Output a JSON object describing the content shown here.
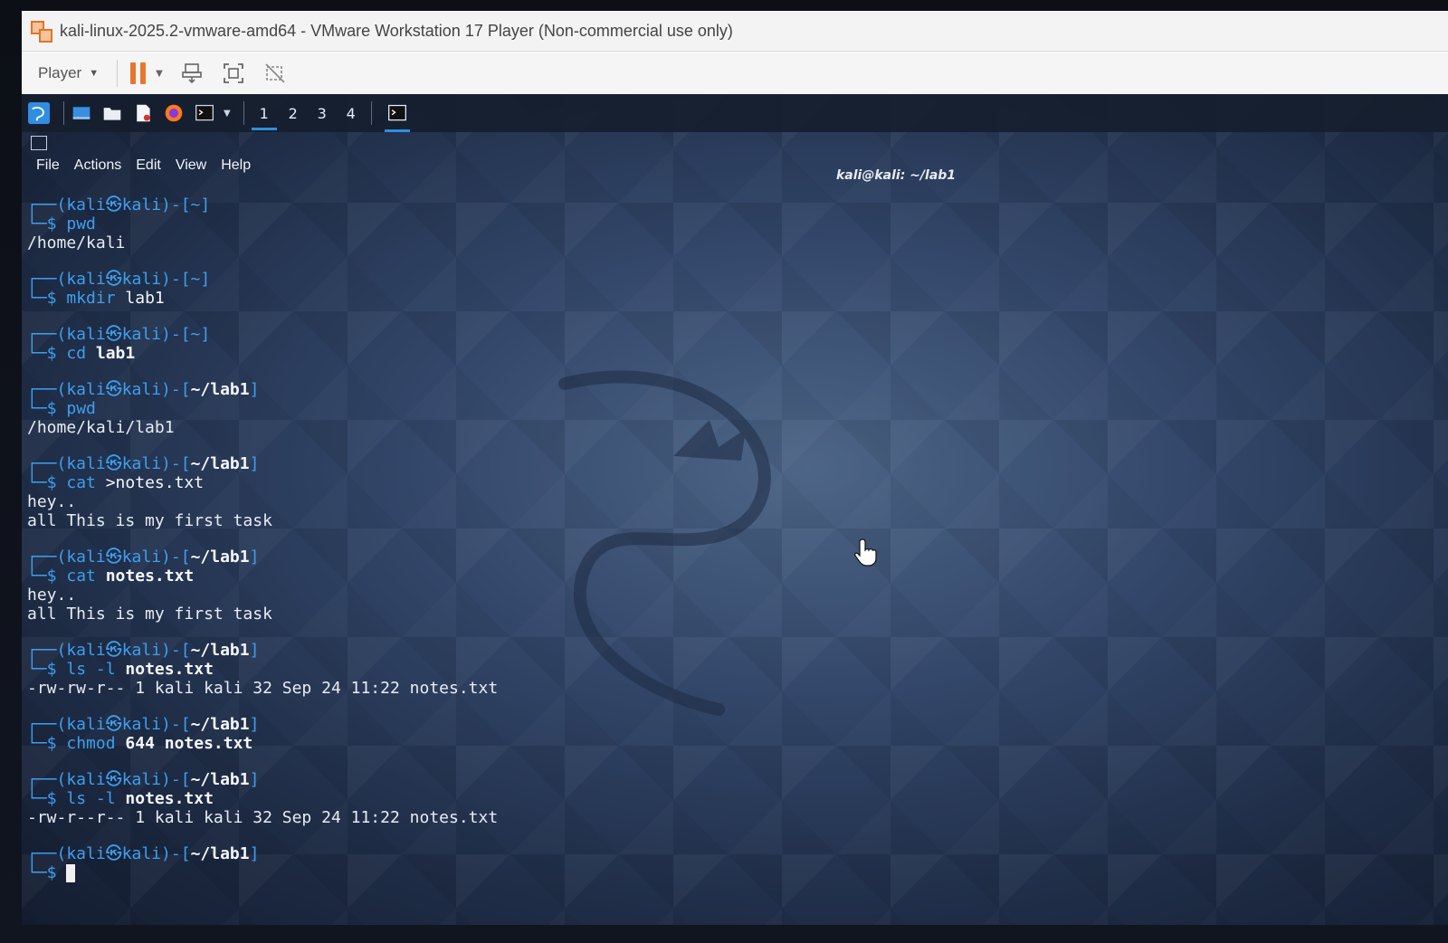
{
  "window": {
    "title": "kali-linux-2025.2-vmware-amd64 - VMware Workstation 17 Player (Non-commercial use only)"
  },
  "toolbar": {
    "player_label": "Player",
    "icons": [
      "pause-icon",
      "send-ctrl-alt-del-icon",
      "fullscreen-icon",
      "unity-icon"
    ]
  },
  "taskbar": {
    "workspaces": [
      "1",
      "2",
      "3",
      "4"
    ],
    "active_workspace": "1"
  },
  "terminal": {
    "title": "kali@kali: ~/lab1",
    "menu": [
      "File",
      "Actions",
      "Edit",
      "View",
      "Help"
    ],
    "lines": {
      "b1_prompt": "┌──(kali㉿kali)-[~]",
      "b1_cmd_a": "└─$ ",
      "b1_cmd_b": "pwd",
      "b1_out1": "/home/kali",
      "b2_prompt": "┌──(kali㉿kali)-[~]",
      "b2_cmd_a": "└─$ ",
      "b2_cmd_b": "mkdir ",
      "b2_cmd_c": "lab1",
      "b3_prompt": "┌──(kali㉿kali)-[~]",
      "b3_cmd_a": "└─$ ",
      "b3_cmd_b": "cd ",
      "b3_cmd_c": "lab1",
      "b4_prompt_a": "┌──(kali㉿kali)-[",
      "b4_prompt_b": "~/lab1",
      "b4_prompt_c": "]",
      "b4_cmd_a": "└─$ ",
      "b4_cmd_b": "pwd",
      "b4_out1": "/home/kali/lab1",
      "b5_prompt_a": "┌──(kali㉿kali)-[",
      "b5_prompt_b": "~/lab1",
      "b5_prompt_c": "]",
      "b5_cmd_a": "└─$ ",
      "b5_cmd_b": "cat ",
      "b5_cmd_c": ">notes.txt",
      "b5_out1": "hey..",
      "b5_out2": "all This is my first task",
      "b6_prompt_a": "┌──(kali㉿kali)-[",
      "b6_prompt_b": "~/lab1",
      "b6_prompt_c": "]",
      "b6_cmd_a": "└─$ ",
      "b6_cmd_b": "cat ",
      "b6_cmd_c": "notes.txt",
      "b6_out1": "hey..",
      "b6_out2": "all This is my first task",
      "b7_prompt_a": "┌──(kali㉿kali)-[",
      "b7_prompt_b": "~/lab1",
      "b7_prompt_c": "]",
      "b7_cmd_a": "└─$ ",
      "b7_cmd_b": "ls -l ",
      "b7_cmd_c": "notes.txt",
      "b7_out1": "-rw-rw-r-- 1 kali kali 32 Sep 24 11:22 notes.txt",
      "b8_prompt_a": "┌──(kali㉿kali)-[",
      "b8_prompt_b": "~/lab1",
      "b8_prompt_c": "]",
      "b8_cmd_a": "└─$ ",
      "b8_cmd_b": "chmod ",
      "b8_cmd_c": "644 notes.txt",
      "b9_prompt_a": "┌──(kali㉿kali)-[",
      "b9_prompt_b": "~/lab1",
      "b9_prompt_c": "]",
      "b9_cmd_a": "└─$ ",
      "b9_cmd_b": "ls -l ",
      "b9_cmd_c": "notes.txt",
      "b9_out1": "-rw-r--r-- 1 kali kali 32 Sep 24 11:22 notes.txt",
      "b10_prompt_a": "┌──(kali㉿kali)-[",
      "b10_prompt_b": "~/lab1",
      "b10_prompt_c": "]",
      "b10_cmd_a": "└─$ "
    }
  },
  "colors": {
    "prompt_blue": "#3d9ff0",
    "accent_orange": "#e8772e",
    "active_underline": "#2f8ee0"
  }
}
